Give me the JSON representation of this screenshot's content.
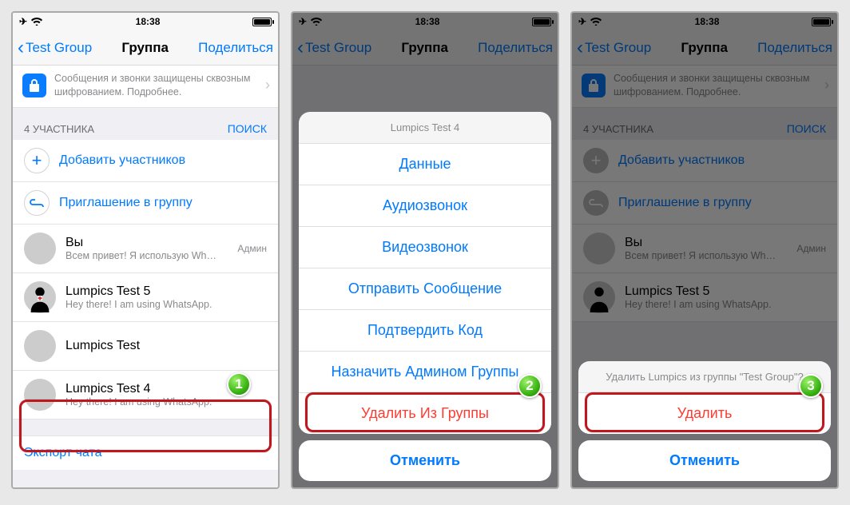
{
  "status": {
    "time": "18:38"
  },
  "nav": {
    "back": "Test Group",
    "title": "Группа",
    "share": "Поделиться"
  },
  "encryption": {
    "text": "Сообщения и звонки защищены сквозным шифрованием. Подробнее."
  },
  "section": {
    "count_label": "4 УЧАСТНИКА",
    "search": "ПОИСК"
  },
  "actions": {
    "add": "Добавить участников",
    "invite": "Приглашение в группу"
  },
  "members": [
    {
      "name": "Вы",
      "sub": "Всем привет! Я использую Wh…",
      "badge": "Админ"
    },
    {
      "name": "Lumpics Test 5",
      "sub": "Hey there! I am using WhatsApp."
    },
    {
      "name": "Lumpics Test",
      "sub": ""
    },
    {
      "name": "Lumpics Test 4",
      "sub": "Hey there! I am using WhatsApp."
    }
  ],
  "export": "Экспорт чата",
  "sheet": {
    "title": "Lumpics Test 4",
    "items": [
      "Данные",
      "Аудиозвонок",
      "Видеозвонок",
      "Отправить Сообщение",
      "Подтвердить Код",
      "Назначить Админом Группы"
    ],
    "remove": "Удалить Из Группы",
    "cancel": "Отменить"
  },
  "confirm": {
    "title": "Удалить Lumpics из группы \"Test Group\"?",
    "delete": "Удалить",
    "cancel": "Отменить"
  },
  "badges": {
    "n1": "1",
    "n2": "2",
    "n3": "3"
  }
}
